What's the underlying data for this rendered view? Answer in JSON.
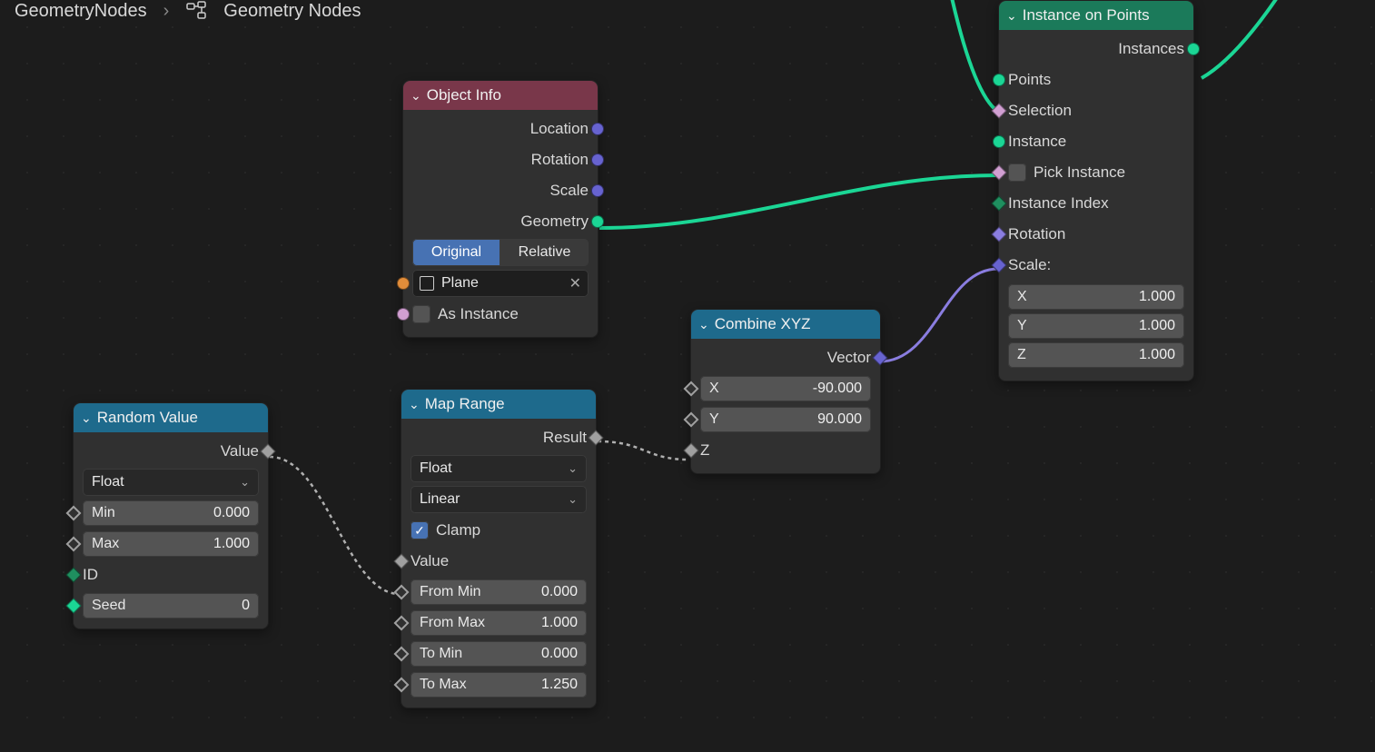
{
  "breadcrumb": {
    "modifier": "GeometryNodes",
    "nodegroup": "Geometry Nodes"
  },
  "instance_on_points": {
    "title": "Instance on Points",
    "out_instances": "Instances",
    "in_points": "Points",
    "in_selection": "Selection",
    "in_instance": "Instance",
    "pick_instance_label": "Pick Instance",
    "in_instance_index": "Instance Index",
    "in_rotation": "Rotation",
    "scale_label": "Scale:",
    "scale_x": {
      "name": "X",
      "val": "1.000"
    },
    "scale_y": {
      "name": "Y",
      "val": "1.000"
    },
    "scale_z": {
      "name": "Z",
      "val": "1.000"
    }
  },
  "object_info": {
    "title": "Object Info",
    "out_location": "Location",
    "out_rotation": "Rotation",
    "out_scale": "Scale",
    "out_geometry": "Geometry",
    "mode_original": "Original",
    "mode_relative": "Relative",
    "object_name": "Plane",
    "as_instance_label": "As Instance"
  },
  "combine_xyz": {
    "title": "Combine XYZ",
    "out_vector": "Vector",
    "x": {
      "name": "X",
      "val": "-90.000"
    },
    "y": {
      "name": "Y",
      "val": "90.000"
    },
    "z_label": "Z"
  },
  "random_value": {
    "title": "Random Value",
    "out_value": "Value",
    "type": "Float",
    "min": {
      "name": "Min",
      "val": "0.000"
    },
    "max": {
      "name": "Max",
      "val": "1.000"
    },
    "id_label": "ID",
    "seed": {
      "name": "Seed",
      "val": "0"
    }
  },
  "map_range": {
    "title": "Map Range",
    "out_result": "Result",
    "data_type": "Float",
    "interp": "Linear",
    "clamp_label": "Clamp",
    "value_label": "Value",
    "from_min": {
      "name": "From Min",
      "val": "0.000"
    },
    "from_max": {
      "name": "From Max",
      "val": "1.000"
    },
    "to_min": {
      "name": "To Min",
      "val": "0.000"
    },
    "to_max": {
      "name": "To Max",
      "val": "1.250"
    }
  }
}
